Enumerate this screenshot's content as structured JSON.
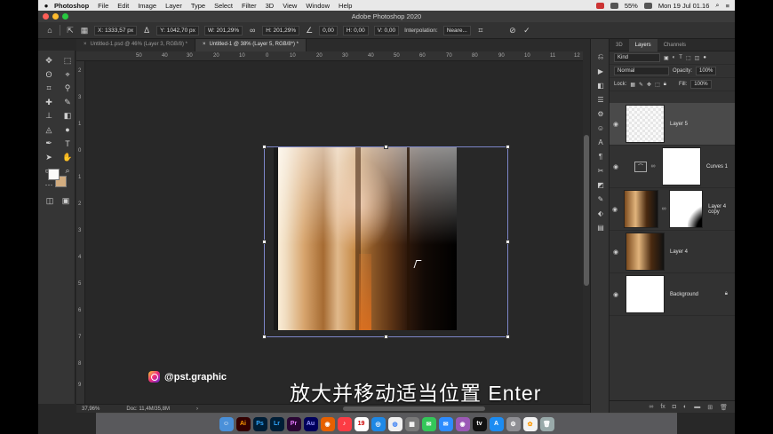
{
  "menubar": {
    "app": "Photoshop",
    "items": [
      "File",
      "Edit",
      "Image",
      "Layer",
      "Type",
      "Select",
      "Filter",
      "3D",
      "View",
      "Window",
      "Help"
    ],
    "battery": "55%",
    "clock": "Mon 19 Jul  01.16"
  },
  "window_title": "Adobe Photoshop 2020",
  "options": {
    "x": "X: 1333,57 px",
    "y": "Y: 1042,70 px",
    "w": "W: 201,29%",
    "h": "H: 201,29%",
    "angle": "0,00",
    "hskew": "H: 0,00",
    "vskew": "V: 0,00",
    "interp_label": "Interpolation:",
    "interp_value": "Neare..."
  },
  "tabs": [
    {
      "label": "Untitled-1.psd @ 46% (Layer 3, RGB/8) *"
    },
    {
      "label": "Untitled-1 @ 38% (Layer 5, RGB/8*) *"
    }
  ],
  "ruler_top": [
    "50",
    "50",
    "40",
    "30",
    "20",
    "10",
    "0",
    "10",
    "20",
    "30",
    "40",
    "50",
    "60",
    "70",
    "80",
    "90",
    "10",
    "11",
    "12"
  ],
  "ruler_left": [
    "2",
    "3",
    "1",
    "0",
    "1",
    "2",
    "3",
    "4",
    "5",
    "6",
    "7",
    "8",
    "9",
    "10"
  ],
  "watermark": "@pst.graphic",
  "subtitle": "放大并移动适当位置 Enter",
  "status": {
    "zoom": "37,96%",
    "doc": "Doc: 11,4M/35,8M"
  },
  "layers_panel": {
    "tabs": [
      "3D",
      "Layers",
      "Channels"
    ],
    "kind": "Kind",
    "blend": "Normal",
    "opacity_label": "Opacity:",
    "opacity": "100%",
    "lock_label": "Lock:",
    "fill_label": "Fill:",
    "fill": "100%",
    "layers": [
      {
        "name": "Layer 5"
      },
      {
        "name": "Curves 1"
      },
      {
        "name": "Layer 4 copy"
      },
      {
        "name": "Layer 4"
      },
      {
        "name": "Background"
      }
    ]
  },
  "colors": {
    "accent": "#7d86c9",
    "bg_swatch": "#d2ac7f"
  },
  "icons": [
    "move-icon",
    "marquee-icon",
    "lasso-icon",
    "brush-icon",
    "eraser-icon",
    "type-icon",
    "hand-icon",
    "zoom-icon",
    "eye-icon",
    "lock-icon",
    "commit-icon",
    "cancel-icon"
  ],
  "dock_icons": [
    "finder",
    "illustrator",
    "photoshop",
    "lightroom",
    "premiere",
    "audition",
    "firefox",
    "music",
    "calendar",
    "safari",
    "chrome",
    "launchpad",
    "messages",
    "mail",
    "podcasts",
    "appletv",
    "appstore",
    "settings",
    "photos",
    "trash"
  ]
}
